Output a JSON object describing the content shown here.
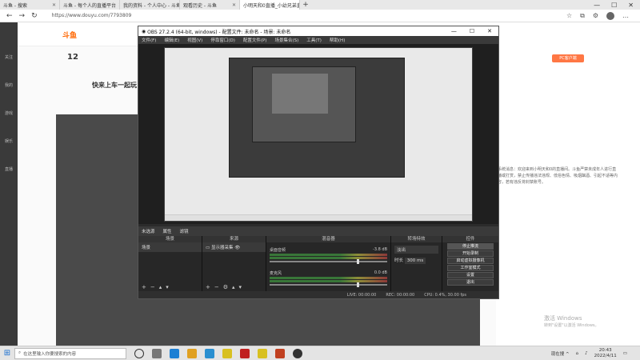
{
  "browser": {
    "tabs": [
      {
        "label": "斗鱼 - 搜索",
        "active": false
      },
      {
        "label": "斗鱼 - 每个人的直播平台",
        "active": false
      },
      {
        "label": "我的资料 - 个人中心 - 斗鱼",
        "active": false
      },
      {
        "label": "观看历史 - 斗鱼",
        "active": false
      },
      {
        "label": "小明天和0直播_小幼兄弟直播...",
        "active": true
      }
    ],
    "url": "https://www.douyu.com/7793809",
    "new_tab": "+",
    "min": "—",
    "max": "☐",
    "close": "✕"
  },
  "site": {
    "stat": "12",
    "banner": "快来上车一起玩!",
    "pc_button": "PC客户端",
    "right_text": "系统消息：欢迎来到小明天和0的直播间。斗鱼严禁未成年人进行直播或打赏，禁止传播违法违规、低俗色情、吸烟酗酒、引起不适等内容，若有违反将封禁账号。",
    "rail": [
      "关注",
      "我的",
      "游戏",
      "娱乐",
      "直播"
    ]
  },
  "obs": {
    "title": "OBS 27.2.4 (64-bit, windows) - 配置文件: 未命名 - 场景: 未命名",
    "menu": [
      "文件(F)",
      "编辑(E)",
      "视图(V)",
      "停靠窗口(D)",
      "配置文件(P)",
      "场景集合(S)",
      "工具(T)",
      "帮助(H)"
    ],
    "scene_bar": [
      "未选源",
      "属性",
      "滤镜"
    ],
    "docks": {
      "scenes": {
        "header": "场景",
        "items": [
          "场景"
        ]
      },
      "sources": {
        "header": "来源",
        "items": [
          "显示器采集"
        ]
      },
      "mixer": {
        "header": "混音器",
        "tracks": [
          {
            "name": "桌面音频",
            "db": "-3.8 dB"
          },
          {
            "name": "麦克风",
            "db": "0.0 dB"
          }
        ]
      },
      "transitions": {
        "header": "转场特效",
        "type": "淡出",
        "duration_label": "时长",
        "duration": "300 ms"
      },
      "controls": {
        "header": "控件",
        "buttons": [
          "停止推流",
          "开始录制",
          "启动虚拟摄像机",
          "工作室模式",
          "设置",
          "退出"
        ]
      }
    },
    "status": [
      "LIVE: 00:00:00",
      "REC: 00:00:00",
      "CPU: 0.4%, 30.00 fps"
    ]
  },
  "taskbar": {
    "search_placeholder": "在这里输入你要搜索的内容",
    "tray_text": "现在搜 ^",
    "time": "20:43",
    "date": "2022/4/11"
  }
}
